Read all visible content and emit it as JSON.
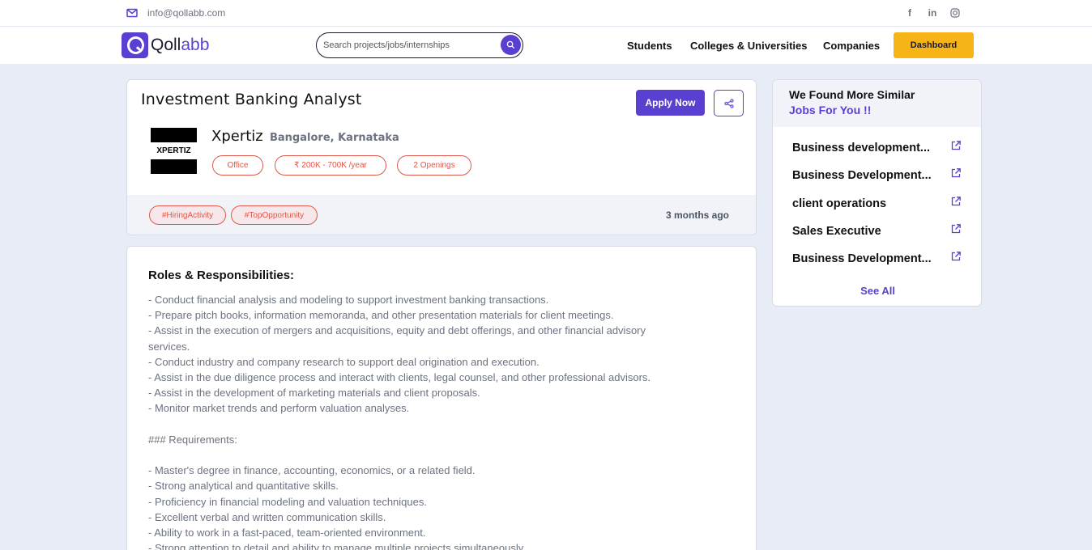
{
  "topbar": {
    "email": "info@qollabb.com",
    "mail_icon": "mail-icon",
    "socials": [
      "facebook-icon",
      "linkedin-icon",
      "instagram-icon"
    ]
  },
  "nav": {
    "logo_text_a": "Qoll",
    "logo_text_b": "abb",
    "search_placeholder": "Search projects/jobs/internships",
    "links": [
      "Students",
      "Colleges & Universities",
      "Companies"
    ],
    "dashboard": "Dashboard",
    "colors": {
      "brand": "#5b3fd0",
      "dashboard_bg": "#f7b416"
    }
  },
  "job": {
    "title": "Investment Banking Analyst",
    "apply_label": "Apply Now",
    "company_logo_text": "XPERTIZ",
    "company": "Xpertiz",
    "location": "Bangalore, Karnataka",
    "pills": [
      "Office",
      "₹ 200K - 700K /year",
      "2 Openings"
    ],
    "tags": [
      "#HiringActivity",
      "#TopOpportunity"
    ],
    "posted": "3 months ago"
  },
  "description": {
    "heading": "Roles & Responsibilities:",
    "lines": [
      "- Conduct financial analysis and modeling to support investment banking transactions.",
      "- Prepare pitch books, information memoranda, and other presentation materials for client meetings.",
      "- Assist in the execution of mergers and acquisitions, equity and debt offerings, and other financial advisory",
      "services.",
      "- Conduct industry and company research to support deal origination and execution.",
      "- Assist in the due diligence process and interact with clients, legal counsel, and other professional advisors.",
      "- Assist in the development of marketing materials and client proposals.",
      "- Monitor market trends and perform valuation analyses.",
      "",
      "### Requirements:",
      "",
      "- Master's degree in finance, accounting, economics, or a related field.",
      "- Strong analytical and quantitative skills.",
      "- Proficiency in financial modeling and valuation techniques.",
      "- Excellent verbal and written communication skills.",
      "- Ability to work in a fast-paced, team-oriented environment.",
      "- Strong attention to detail and ability to manage multiple projects simultaneously."
    ]
  },
  "sidebar": {
    "heading_line1": "We Found More Similar",
    "heading_line2": "Jobs For You !!",
    "items": [
      "Business development...",
      "Business Development...",
      "client operations",
      "Sales Executive",
      "Business Development..."
    ],
    "see_all": "See All"
  }
}
